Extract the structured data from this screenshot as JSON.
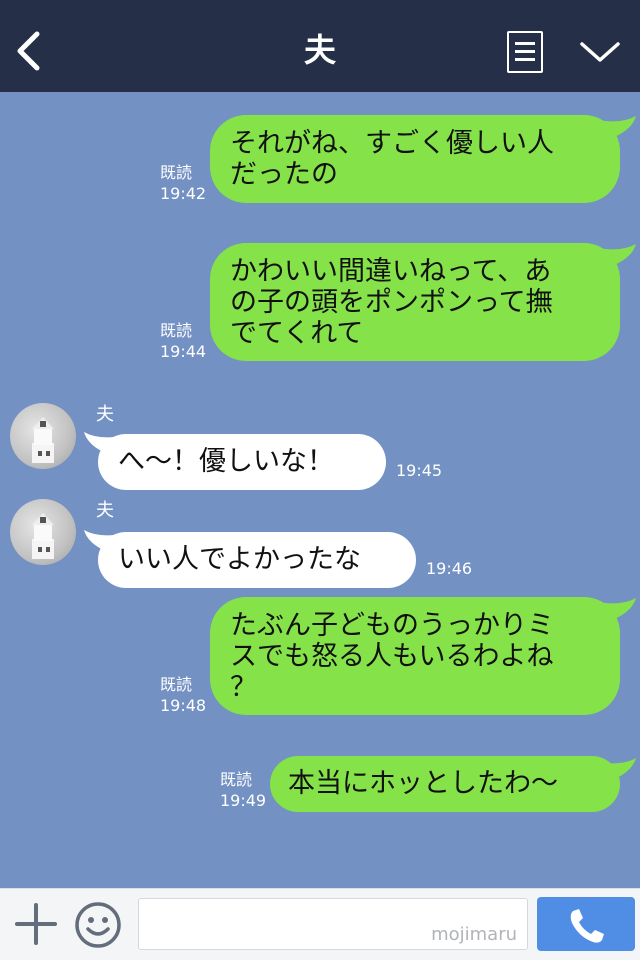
{
  "header": {
    "title": "夫"
  },
  "messages": [
    {
      "sent": true,
      "text": "それがね、すごく優しい人\nだったの",
      "read": "既読",
      "time": "19:42"
    },
    {
      "sent": true,
      "text": "かわいい間違いねって、あ\nの子の頭をポンポンって撫\nでてくれて",
      "read": "既読",
      "time": "19:44"
    },
    {
      "sent": false,
      "sender": "夫",
      "text": "へ〜！優しいな！",
      "time": "19:45"
    },
    {
      "sent": false,
      "sender": "夫",
      "text": "いい人でよかったな",
      "time": "19:46"
    },
    {
      "sent": true,
      "text": "たぶん子どものうっかりミ\nスでも怒る人もいるわよね\n？",
      "read": "既読",
      "time": "19:48"
    },
    {
      "sent": true,
      "text": "本当にホッとしたわ〜",
      "read": "既読",
      "time": "19:49"
    }
  ],
  "input": {
    "watermark": "mojimaru"
  },
  "icons": {
    "back": "back-arrow-icon",
    "menu": "note-menu-icon",
    "collapse": "chevron-down-icon",
    "add": "plus-icon",
    "emoji": "smiley-icon",
    "call": "phone-icon"
  },
  "colors": {
    "header_bg": "#253048",
    "chat_bg": "#7391c3",
    "sent_bubble": "#85e249",
    "received_bubble": "#ffffff",
    "call_button": "#4f8ee4"
  }
}
